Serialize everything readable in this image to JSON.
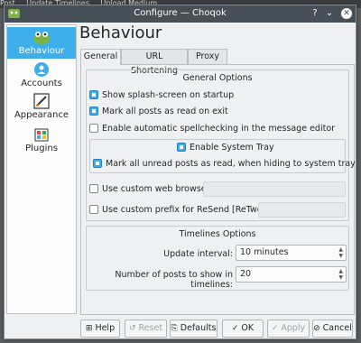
{
  "background": {
    "items": [
      "Post",
      "Update Timelines",
      "Upload Medium"
    ]
  },
  "window": {
    "title": "Configure — Choqok",
    "help_glyph": "?",
    "min_glyph": "⌄",
    "max_glyph": "⌃",
    "close_glyph": "✕"
  },
  "sidebar": {
    "items": [
      {
        "label": "Behaviour",
        "icon": "behaviour-icon",
        "selected": true
      },
      {
        "label": "Accounts",
        "icon": "accounts-icon",
        "selected": false
      },
      {
        "label": "Appearance",
        "icon": "appearance-icon",
        "selected": false
      },
      {
        "label": "Plugins",
        "icon": "plugins-icon",
        "selected": false
      }
    ]
  },
  "page": {
    "title": "Behaviour",
    "tabs": [
      {
        "label": "General",
        "selected": true
      },
      {
        "label": "URL Shortening",
        "selected": false
      },
      {
        "label": "Proxy",
        "selected": false
      }
    ]
  },
  "general": {
    "title": "General Options",
    "splash": {
      "label": "Show splash-screen on startup",
      "checked": true
    },
    "mark_read_exit": {
      "label": "Mark all posts as read on exit",
      "checked": true
    },
    "spellcheck": {
      "label": "Enable automatic spellchecking in the message editor",
      "checked": false
    },
    "system_tray": {
      "label": "Enable System Tray",
      "checked": true
    },
    "mark_unread_hide": {
      "label": "Mark all unread posts as read, when hiding to system tray",
      "checked": true
    },
    "custom_browser": {
      "label": "Use custom web browser:",
      "checked": false,
      "value": ""
    },
    "custom_prefix": {
      "label": "Use custom prefix for ReSend [ReTweet]:",
      "checked": false,
      "value": ""
    }
  },
  "timelines": {
    "title": "Timelines Options",
    "update_interval": {
      "label": "Update interval:",
      "value": "10 minutes"
    },
    "posts_count": {
      "label": "Number of posts to show in timelines:",
      "value": "20"
    }
  },
  "buttons": {
    "help": "Help",
    "reset": "Reset",
    "defaults": "Defaults",
    "ok": "OK",
    "apply": "Apply",
    "cancel": "Cancel"
  },
  "colors": {
    "accent": "#3daee9",
    "titlebar": "#475057",
    "window": "#eff0f1"
  }
}
